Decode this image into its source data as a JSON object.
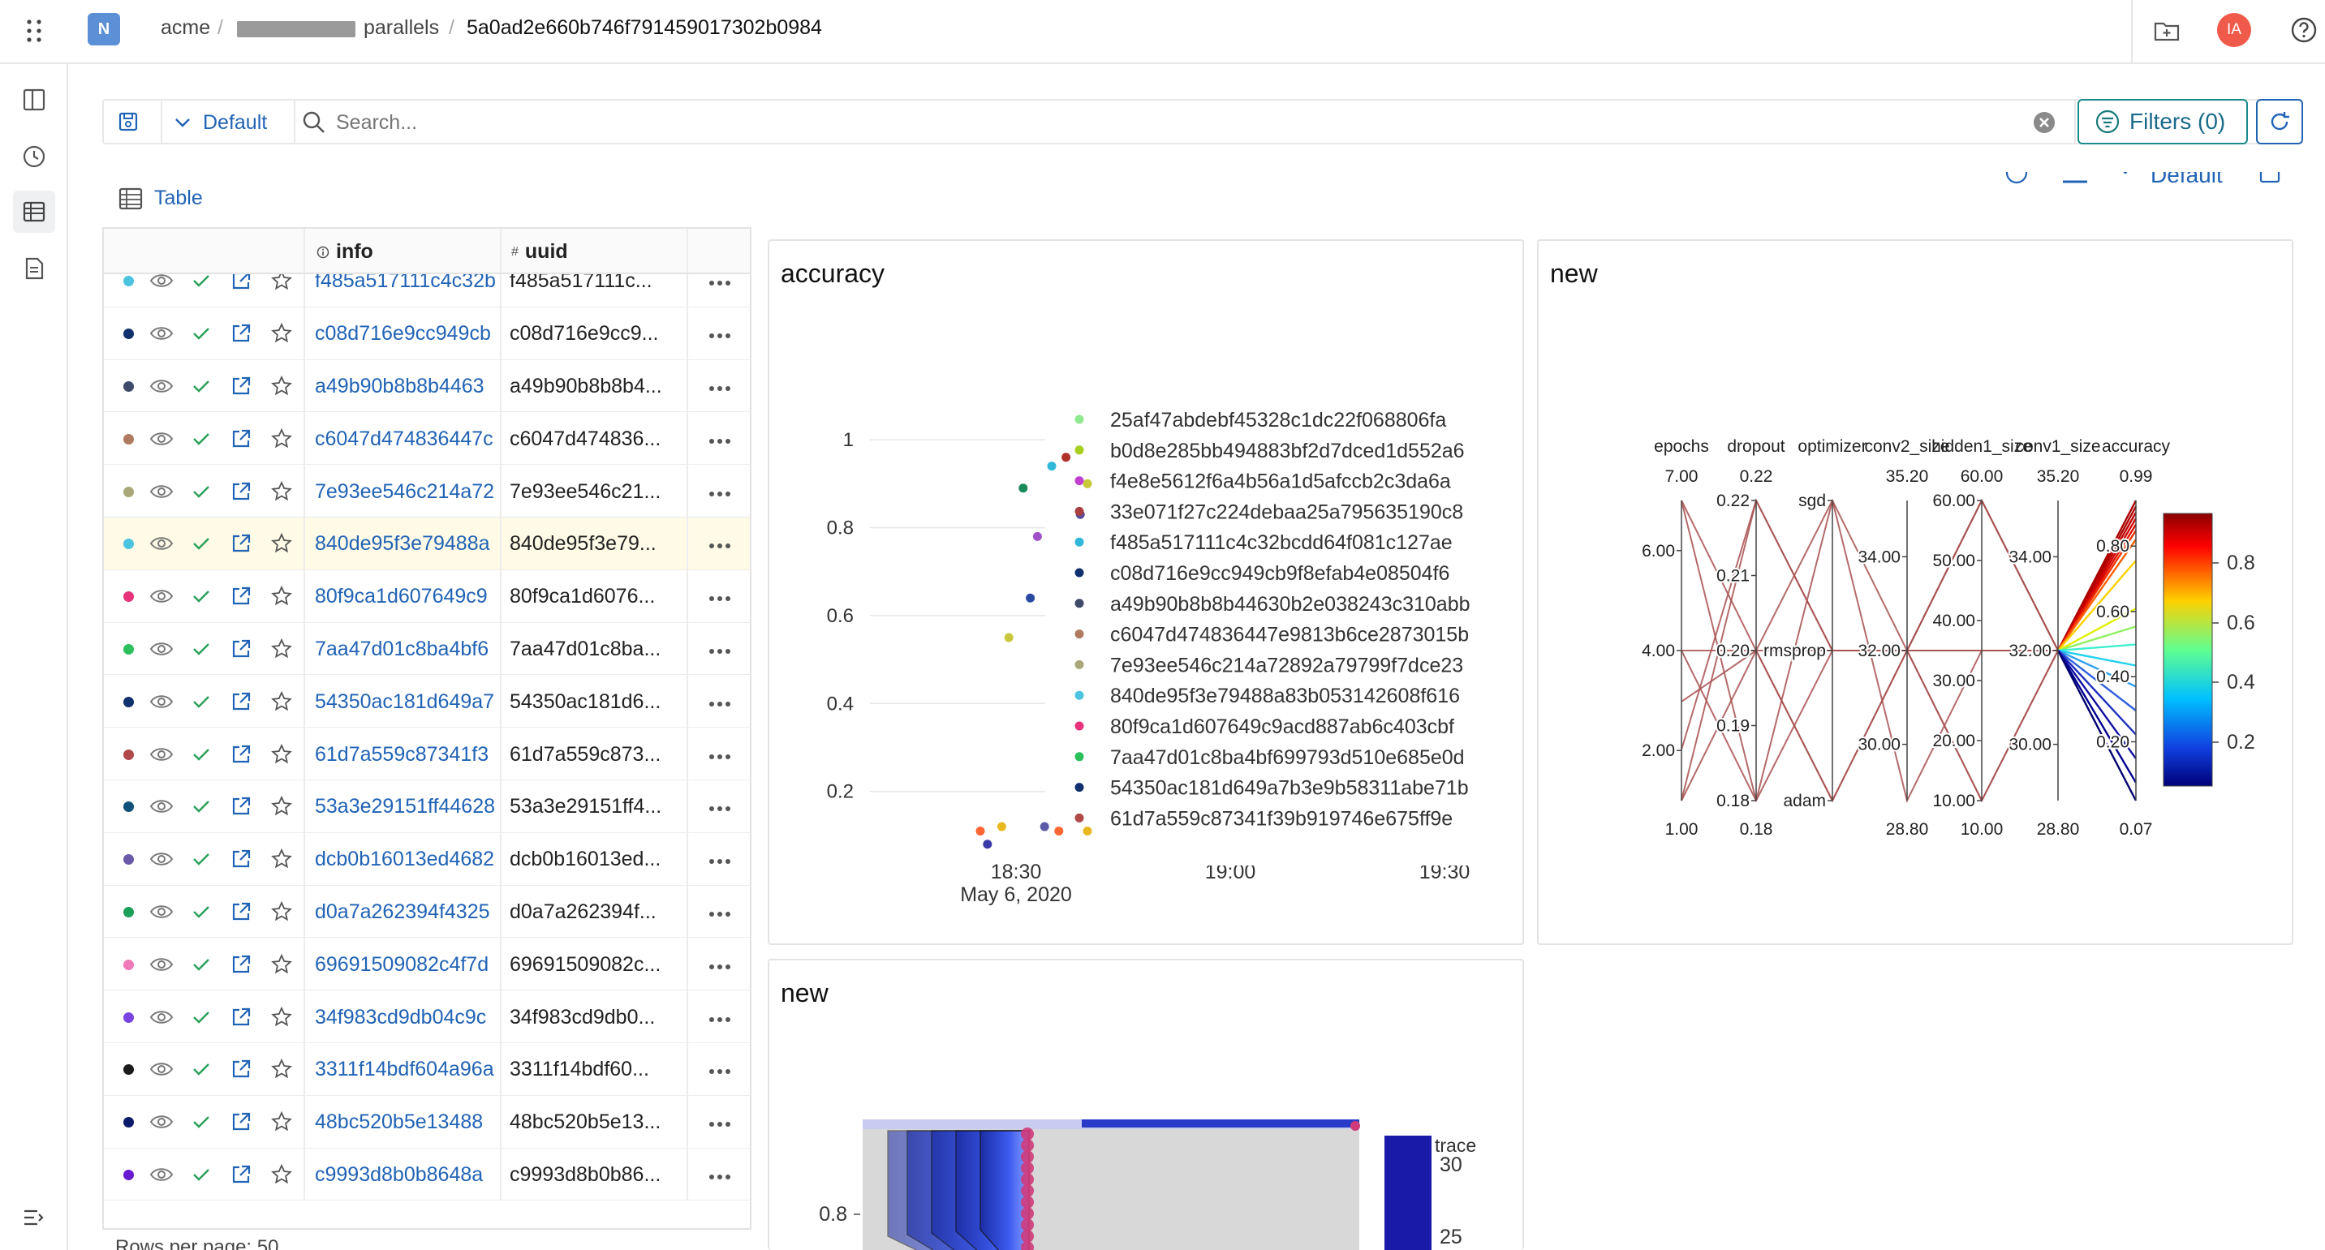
{
  "header": {
    "org_badge": "N",
    "crumbs": [
      "acme",
      "parallels",
      "5a0ad2e660b746f791459017302b0984"
    ],
    "user_initials": "IA"
  },
  "toolbar": {
    "view_label": "Default",
    "search_placeholder": "Search...",
    "filters_label": "Filters (0)"
  },
  "table": {
    "title": "Table",
    "col_info": "info",
    "col_uuid": "uuid",
    "rows": [
      {
        "color": "#4cc4e0",
        "info": "f485a517111c4c32b",
        "uuid": "f485a517111c..."
      },
      {
        "color": "#10306e",
        "info": "c08d716e9cc949cb",
        "uuid": "c08d716e9cc9..."
      },
      {
        "color": "#3f4a6a",
        "info": "a49b90b8b8b4463",
        "uuid": "a49b90b8b8b4..."
      },
      {
        "color": "#b07a5e",
        "info": "c6047d474836447c",
        "uuid": "c6047d474836..."
      },
      {
        "color": "#a8a878",
        "info": "7e93ee546c214a72",
        "uuid": "7e93ee546c21..."
      },
      {
        "color": "#4cc4e0",
        "info": "840de95f3e79488a",
        "uuid": "840de95f3e79...",
        "highlight": true
      },
      {
        "color": "#e8337a",
        "info": "80f9ca1d607649c9",
        "uuid": "80f9ca1d6076..."
      },
      {
        "color": "#2cc05c",
        "info": "7aa47d01c8ba4bf6",
        "uuid": "7aa47d01c8ba..."
      },
      {
        "color": "#10306e",
        "info": "54350ac181d649a7",
        "uuid": "54350ac181d6..."
      },
      {
        "color": "#b04a4a",
        "info": "61d7a559c87341f3",
        "uuid": "61d7a559c873..."
      },
      {
        "color": "#10507a",
        "info": "53a3e29151ff44628",
        "uuid": "53a3e29151ff4..."
      },
      {
        "color": "#6a5aa8",
        "info": "dcb0b16013ed4682",
        "uuid": "dcb0b16013ed..."
      },
      {
        "color": "#1aa05a",
        "info": "d0a7a262394f4325",
        "uuid": "d0a7a262394f..."
      },
      {
        "color": "#f07ab8",
        "info": "69691509082c4f7d",
        "uuid": "69691509082c..."
      },
      {
        "color": "#7a44e0",
        "info": "34f983cd9db04c9c",
        "uuid": "34f983cd9db0..."
      },
      {
        "color": "#1a1a1a",
        "info": "3311f14bdf604a96a",
        "uuid": "3311f14bdf60..."
      },
      {
        "color": "#0c1a6a",
        "info": "48bc520b5e13488",
        "uuid": "48bc520b5e13..."
      },
      {
        "color": "#6a1ad0",
        "info": "c9993d8b0b8648a",
        "uuid": "c9993d8b0b86..."
      }
    ],
    "rows_per_page_label": "Rows per page: 50"
  },
  "panels": {
    "view_label": "Default",
    "accuracy_title": "accuracy",
    "parcoords_title": "new",
    "contour_title": "new"
  },
  "chart_data": [
    {
      "type": "scatter",
      "title": "accuracy",
      "x_ticks": [
        "18:30",
        "19:00",
        "19:30"
      ],
      "x_subtitle": "May 6, 2020",
      "y_ticks": [
        "1",
        "0.8",
        "0.6",
        "0.4",
        "0.2"
      ],
      "ylim": [
        0.05,
        1.05
      ],
      "xlim": [
        "18:10",
        "19:40"
      ],
      "points": [
        {
          "x": "18:25",
          "y": 0.11,
          "color": "#ff6633"
        },
        {
          "x": "18:26",
          "y": 0.08,
          "color": "#3a3aa8"
        },
        {
          "x": "18:28",
          "y": 0.12,
          "color": "#e8b820"
        },
        {
          "x": "18:29",
          "y": 0.55,
          "color": "#c8c83a"
        },
        {
          "x": "18:31",
          "y": 0.89,
          "color": "#1a8a5a"
        },
        {
          "x": "18:32",
          "y": 0.64,
          "color": "#2a4aa0"
        },
        {
          "x": "18:33",
          "y": 0.78,
          "color": "#a050c8"
        },
        {
          "x": "18:34",
          "y": 0.12,
          "color": "#5a5aa8"
        },
        {
          "x": "18:35",
          "y": 0.94,
          "color": "#30b8d8"
        },
        {
          "x": "18:36",
          "y": 0.11,
          "color": "#ff6633"
        },
        {
          "x": "18:37",
          "y": 0.96,
          "color": "#b0302a"
        },
        {
          "x": "18:39",
          "y": 0.83,
          "color": "#5a4a9a"
        },
        {
          "x": "18:40",
          "y": 0.9,
          "color": "#c8c83a"
        },
        {
          "x": "18:40",
          "y": 0.11,
          "color": "#e8b820"
        }
      ],
      "legend": [
        {
          "name": "25af47abdebf45328c1dc22f068806fa",
          "color": "#90e890"
        },
        {
          "name": "b0d8e285bb494883bf2d7dced1d552a6",
          "color": "#a8d020"
        },
        {
          "name": "f4e8e5612f6a4b56a1d5afccb2c3da6a",
          "color": "#c040d0"
        },
        {
          "name": "33e071f27c224debaa25a795635190c8",
          "color": "#a84040"
        },
        {
          "name": "f485a517111c4c32bcdd64f081c127ae",
          "color": "#30b8d8"
        },
        {
          "name": "c08d716e9cc949cb9f8efab4e08504f6",
          "color": "#10306e"
        },
        {
          "name": "a49b90b8b8b44630b2e038243c310abb",
          "color": "#3f4a6a"
        },
        {
          "name": "c6047d474836447e9813b6ce2873015b",
          "color": "#b07a5e"
        },
        {
          "name": "7e93ee546c214a72892a79799f7dce23",
          "color": "#a8a878"
        },
        {
          "name": "840de95f3e79488a83b053142608f616",
          "color": "#4cc4e0"
        },
        {
          "name": "80f9ca1d607649c9acd887ab6c403cbf",
          "color": "#e8337a"
        },
        {
          "name": "7aa47d01c8ba4bf699793d510e685e0d",
          "color": "#2cc05c"
        },
        {
          "name": "54350ac181d649a7b3e9b58311abe71b",
          "color": "#10306e"
        },
        {
          "name": "61d7a559c87341f39b919746e675ff9e",
          "color": "#b04a4a"
        }
      ]
    },
    {
      "type": "parallel-coordinates",
      "title": "new",
      "axes": [
        {
          "name": "epochs",
          "top": "7.00",
          "bottom": "1.00",
          "ticks": [
            "6.00",
            "4.00",
            "2.00"
          ]
        },
        {
          "name": "dropout",
          "top": "0.22",
          "bottom": "0.18",
          "ticks": [
            "0.22",
            "0.21",
            "0.20",
            "0.19",
            "0.18"
          ]
        },
        {
          "name": "optimizer",
          "top": "",
          "bottom": "",
          "ticks": [
            "sgd",
            "rmsprop",
            "adam"
          ]
        },
        {
          "name": "conv2_size",
          "top": "35.20",
          "bottom": "28.80",
          "ticks": [
            "34.00",
            "32.00",
            "30.00"
          ]
        },
        {
          "name": "hidden1_size",
          "top": "60.00",
          "bottom": "10.00",
          "ticks": [
            "60.00",
            "50.00",
            "40.00",
            "30.00",
            "20.00",
            "10.00"
          ]
        },
        {
          "name": "conv1_size",
          "top": "35.20",
          "bottom": "28.80",
          "ticks": [
            "34.00",
            "32.00",
            "30.00"
          ]
        },
        {
          "name": "accuracy",
          "top": "0.99",
          "bottom": "0.07",
          "ticks": [
            "0.80",
            "0.60",
            "0.40",
            "0.20"
          ]
        }
      ],
      "colorbar_ticks": [
        "0.8",
        "0.6",
        "0.4",
        "0.2"
      ]
    },
    {
      "type": "heatmap",
      "title": "new",
      "y_ticks": [
        "0.8"
      ],
      "colorbar_title": "trace",
      "colorbar_ticks": [
        "30",
        "25"
      ]
    }
  ]
}
